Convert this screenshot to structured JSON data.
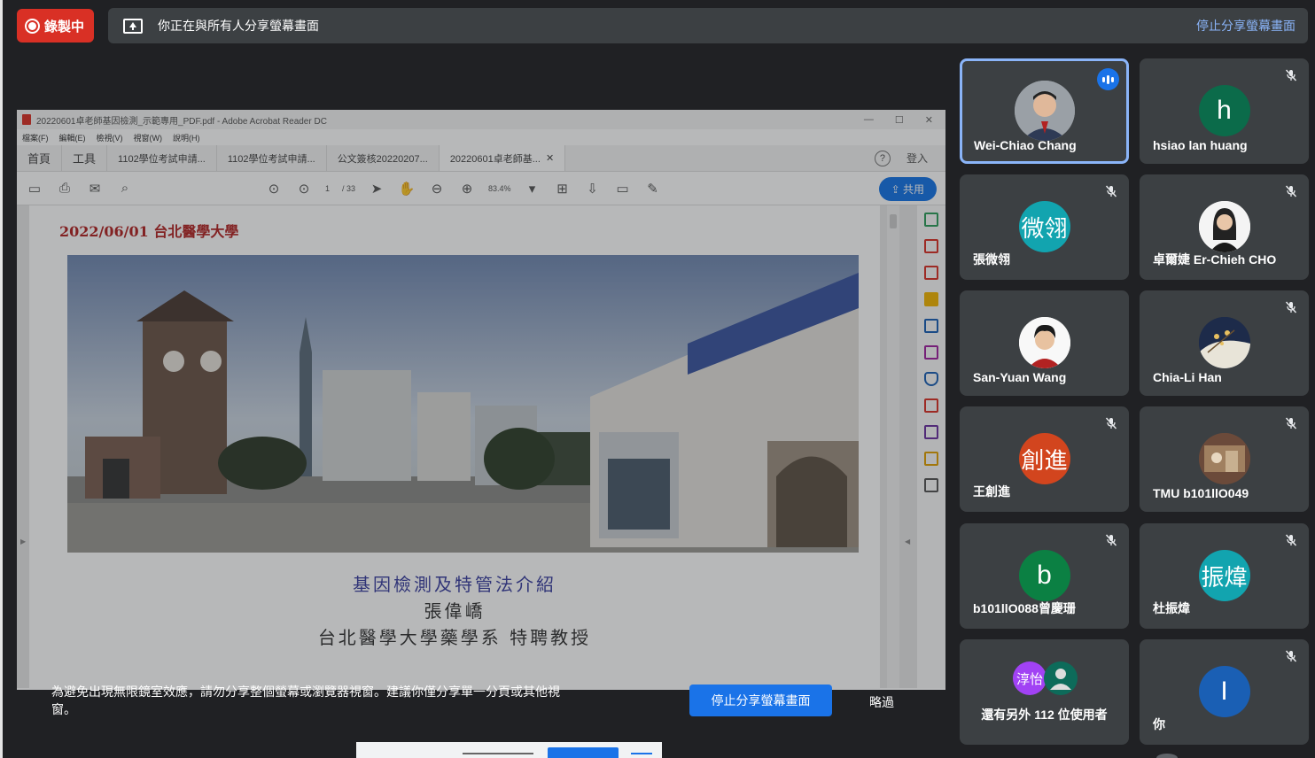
{
  "recording": {
    "label": "錄製中"
  },
  "share_bar": {
    "message": "你正在與所有人分享螢幕畫面",
    "stop_link": "停止分享螢幕畫面"
  },
  "acrobat": {
    "title": "20220601卓老師基因檢測_示範專用_PDF.pdf - Adobe Acrobat Reader DC",
    "menu": [
      "檔案(F)",
      "編輯(E)",
      "檢視(V)",
      "視窗(W)",
      "說明(H)"
    ],
    "tabs": [
      "首頁",
      "工具",
      "1102學位考試申請...",
      "1102學位考試申請...",
      "公文簽核20220207...",
      "20220601卓老師基..."
    ],
    "sign_in": "登入",
    "page_current": "1",
    "page_total": "/ 33",
    "zoom": "83.4%",
    "share_btn": "共用",
    "page": {
      "date_line": "2022/06/01 台北醫學大學",
      "talk_title": "基因檢測及特管法介紹",
      "speaker": "張偉嶠",
      "affiliation": "台北醫學大學藥學系 特聘教授"
    }
  },
  "warning": {
    "text": "為避免出現無限鏡室效應，請勿分享整個螢幕或瀏覽器視窗。建議你僅分享單一分頁或其他視窗。",
    "stop_button": "停止分享螢幕畫面",
    "skip": "略過"
  },
  "participants": [
    {
      "name": "Wei-Chiao Chang",
      "avatar_text": "",
      "avatar_color": "#9aa0a6",
      "speaking": true,
      "muted": false
    },
    {
      "name": "hsiao lan huang",
      "avatar_text": "h",
      "avatar_color": "#0b6b4a",
      "speaking": false,
      "muted": true
    },
    {
      "name": "張微翎",
      "avatar_text": "微翎",
      "avatar_color": "#12a4af",
      "speaking": false,
      "muted": true
    },
    {
      "name": "卓爾婕 Er-Chieh CHO",
      "avatar_text": "",
      "avatar_color": "#ffffff",
      "speaking": false,
      "muted": true
    },
    {
      "name": "San-Yuan Wang",
      "avatar_text": "",
      "avatar_color": "#ffffff",
      "speaking": false,
      "muted": false
    },
    {
      "name": "Chia-Li Han",
      "avatar_text": "",
      "avatar_color": "#1d2b4a",
      "speaking": false,
      "muted": true
    },
    {
      "name": "王創進",
      "avatar_text": "創進",
      "avatar_color": "#d2451e",
      "speaking": false,
      "muted": true
    },
    {
      "name": "TMU b101llO049",
      "avatar_text": "",
      "avatar_color": "#6b4a3a",
      "speaking": false,
      "muted": true
    },
    {
      "name": "b101llO088曾慶珊",
      "avatar_text": "b",
      "avatar_color": "#0b8043",
      "speaking": false,
      "muted": true
    },
    {
      "name": "杜振煒",
      "avatar_text": "振煒",
      "avatar_color": "#12a4af",
      "speaking": false,
      "muted": true
    },
    {
      "name": "你",
      "avatar_text": "I",
      "avatar_color": "#1a5fb4",
      "speaking": false,
      "muted": true
    }
  ],
  "more_participants": {
    "label": "還有另外 112 位使用者",
    "avatar1_text": "淳怡",
    "avatar1_color": "#a142f4",
    "avatar2_color": "#0d6b5a"
  }
}
